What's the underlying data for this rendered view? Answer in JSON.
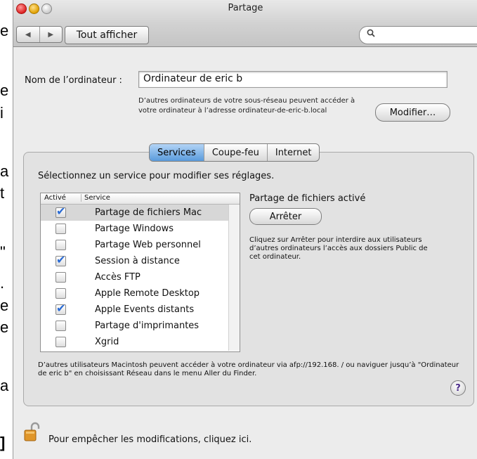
{
  "background_glyphs": [
    "e",
    "e",
    "i",
    "a",
    "t",
    "\"",
    ".",
    "e",
    "e",
    "a",
    "]"
  ],
  "window": {
    "title": "Partage"
  },
  "toolbar": {
    "back_label": "◀",
    "forward_label": "▶",
    "show_all_label": "Tout afficher",
    "search_placeholder": ""
  },
  "computer_name": {
    "label": "Nom de l’ordinateur :",
    "value": "Ordinateur de eric b",
    "note": "D’autres ordinateurs de votre sous-réseau peuvent accéder à votre ordinateur à l’adresse ordinateur-de-eric-b.local",
    "modify_label": "Modifier…"
  },
  "tabs": [
    {
      "label": "Services",
      "active": true
    },
    {
      "label": "Coupe-feu",
      "active": false
    },
    {
      "label": "Internet",
      "active": false
    }
  ],
  "services": {
    "hint": "Sélectionnez un service pour modifier ses réglages.",
    "col_active": "Activé",
    "col_service": "Service",
    "items": [
      {
        "name": "Partage de fichiers Mac",
        "checked": true,
        "selected": true
      },
      {
        "name": "Partage Windows",
        "checked": false
      },
      {
        "name": "Partage Web personnel",
        "checked": false
      },
      {
        "name": "Session à distance",
        "checked": true
      },
      {
        "name": "Accès FTP",
        "checked": false
      },
      {
        "name": "Apple Remote Desktop",
        "checked": false
      },
      {
        "name": "Apple Events distants",
        "checked": true
      },
      {
        "name": "Partage d'imprimantes",
        "checked": false
      },
      {
        "name": "Xgrid",
        "checked": false
      }
    ],
    "status_title": "Partage de fichiers activé",
    "stop_label": "Arrêter",
    "status_desc": "Cliquez sur Arrêter pour interdire aux utilisateurs d’autres ordinateurs l’accès aux dossiers Public de cet ordinateur.",
    "footer_note": "D’autres utilisateurs Macintosh peuvent accéder à votre ordinateur via afp://192.168.     / ou naviguer jusqu’à \"Ordinateur de eric b\" en choisissant Réseau dans le menu Aller du Finder.",
    "help_label": "?"
  },
  "lock": {
    "text": "Pour empêcher les modifications, cliquez ici."
  },
  "colors": {
    "tab_active": "#5a9bdc",
    "checkmark": "#2a6bd4",
    "window_bg": "#ececec"
  }
}
